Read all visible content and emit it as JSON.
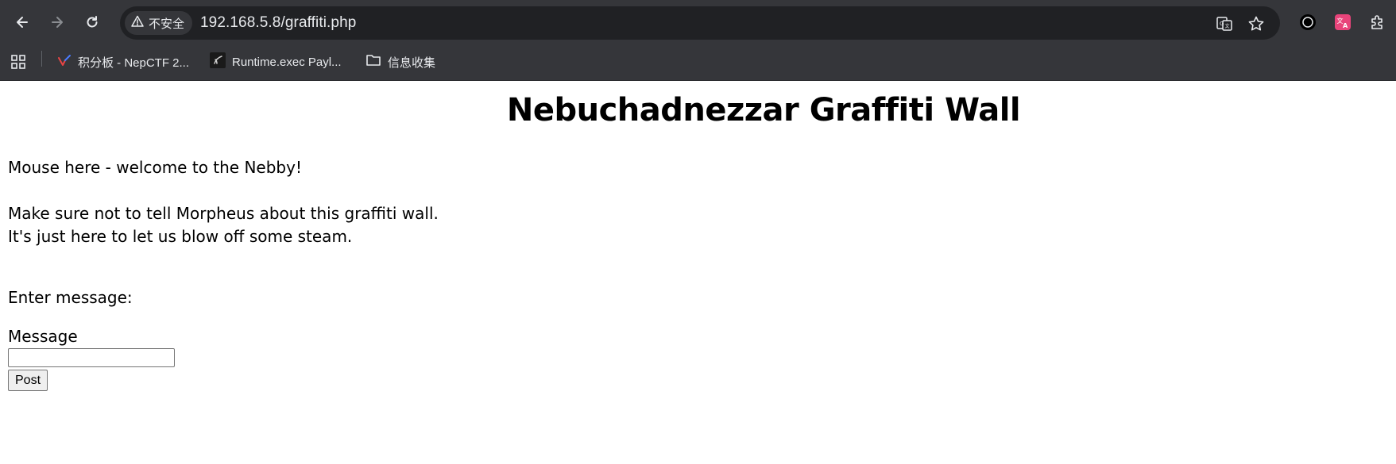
{
  "browser": {
    "security_label": "不安全",
    "url": "192.168.5.8/graffiti.php",
    "bookmarks": [
      {
        "label": "积分板 - NepCTF 2..."
      },
      {
        "label": "Runtime.exec Payl..."
      },
      {
        "label": "信息收集"
      }
    ]
  },
  "page": {
    "title": "Nebuchadnezzar Graffiti Wall",
    "welcome": "Mouse here - welcome to the Nebby!",
    "line1": "Make sure not to tell Morpheus about this graffiti wall.",
    "line2": "It's just here to let us blow off some steam.",
    "enter_label": "Enter message:",
    "message_label": "Message",
    "message_value": "",
    "post_label": "Post"
  },
  "colors": {
    "chrome_bg": "#35363a",
    "omnibox_bg": "#202124",
    "chrome_text": "#e8eaed",
    "extension_pink": "#e8447a"
  }
}
